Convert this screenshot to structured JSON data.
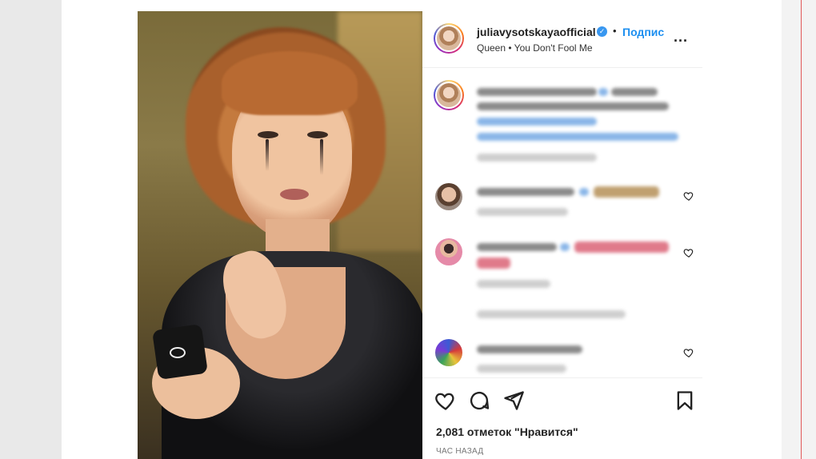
{
  "post": {
    "username": "juliavysotskayaofficial",
    "verified_mark": "✓",
    "separator": "•",
    "follow_label": "Подписаться",
    "audio": "Queen • You Don't Fool Me",
    "more_label": "..."
  },
  "footer": {
    "likes_text": "2,081 отметок \"Нравится\"",
    "time_text": "ЧАС НАЗАД"
  },
  "icons": [
    "heart-icon",
    "comment-icon",
    "share-icon",
    "bookmark-icon",
    "verified-icon",
    "more-icon"
  ],
  "colors": {
    "accent_blue": "#1d8ff0",
    "text_dark": "#222222",
    "page_bg": "#e9e9e9",
    "frame_red": "#e25a5a"
  }
}
